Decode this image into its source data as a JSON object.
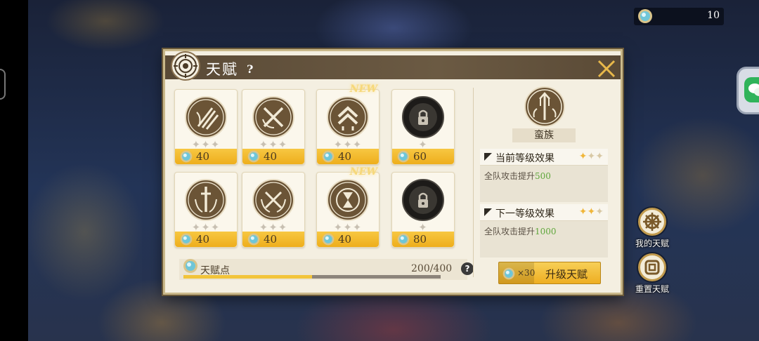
{
  "resource": {
    "icon": "gem-icon",
    "value": "10"
  },
  "dialog": {
    "title": "天赋",
    "help": "?",
    "close_icon": "close-icon"
  },
  "talents": [
    {
      "icon": "claw-slash-icon",
      "stars_total": 3,
      "stars_lit": 0,
      "cost": "40",
      "new": false
    },
    {
      "icon": "crossed-swords-icon",
      "stars_total": 3,
      "stars_lit": 0,
      "cost": "40",
      "new": false
    },
    {
      "icon": "chevron-rank-icon",
      "stars_total": 3,
      "stars_lit": 0,
      "cost": "40",
      "new": true,
      "new_label": "NEW"
    },
    {
      "icon": "locked-talent-icon",
      "stars_total": 1,
      "stars_lit": 0,
      "cost": "60",
      "new": false,
      "locked": true
    },
    {
      "icon": "sword-wings-icon",
      "stars_total": 3,
      "stars_lit": 0,
      "cost": "40",
      "new": false
    },
    {
      "icon": "crossed-swords-wings-icon",
      "stars_total": 3,
      "stars_lit": 0,
      "cost": "40",
      "new": false
    },
    {
      "icon": "hourglass-icon",
      "stars_total": 3,
      "stars_lit": 0,
      "cost": "40",
      "new": true,
      "new_label": "NEW"
    },
    {
      "icon": "locked-talent-icon",
      "stars_total": 1,
      "stars_lit": 0,
      "cost": "80",
      "new": false,
      "locked": true
    }
  ],
  "progress": {
    "label": "天赋点",
    "value_text": "200/400",
    "fraction": 0.5,
    "help": "?"
  },
  "detail": {
    "icon": "trident-wings-icon",
    "name": "蛮族",
    "current": {
      "title": "当前等级效果",
      "stars_total": 3,
      "stars_lit": 1,
      "text_prefix": "全队攻击提升",
      "value": "500"
    },
    "next": {
      "title": "下一等级效果",
      "stars_total": 3,
      "stars_lit": 2,
      "text_prefix": "全队攻击提升",
      "value": "1000"
    },
    "upgrade": {
      "cost_mult": "×30",
      "label": "升级天赋"
    }
  },
  "side_buttons": [
    {
      "label": "我的天赋",
      "icon": "ship-wheel-icon"
    },
    {
      "label": "重置天赋",
      "icon": "reset-icon"
    }
  ],
  "colors": {
    "gold": "#f0b63a",
    "brown": "#6b5a43",
    "green": "#5ea63a"
  }
}
